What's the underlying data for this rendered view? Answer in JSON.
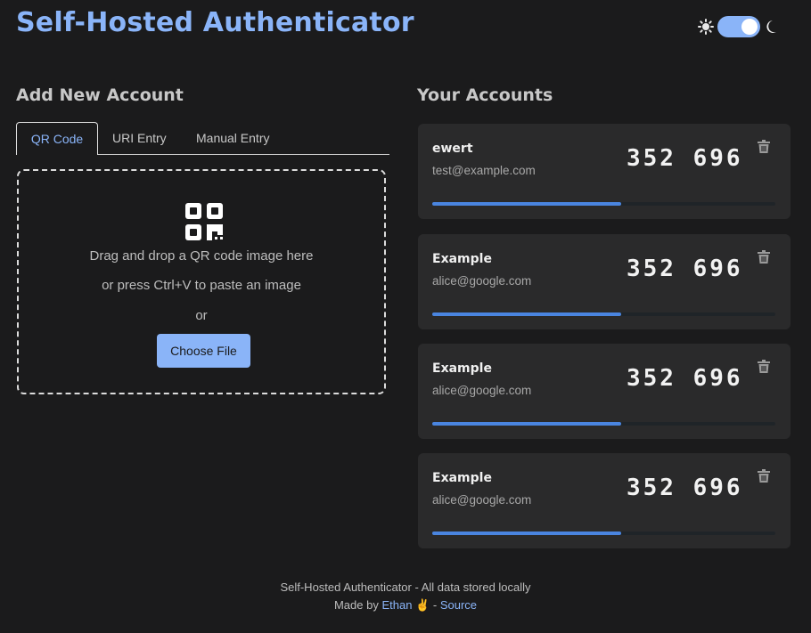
{
  "header": {
    "title": "Self-Hosted Authenticator"
  },
  "theme": {
    "sun_icon": "sun-icon",
    "moon_icon": "moon-icon",
    "dark_mode": true
  },
  "add_section": {
    "title": "Add New Account",
    "tabs": [
      {
        "label": "QR Code",
        "active": true
      },
      {
        "label": "URI Entry",
        "active": false
      },
      {
        "label": "Manual Entry",
        "active": false
      }
    ],
    "dropzone": {
      "icon": "qr-code-icon",
      "line1": "Drag and drop a QR code image here",
      "line2": "or press Ctrl+V to paste an image",
      "line3": "or",
      "button_label": "Choose File"
    }
  },
  "accounts_section": {
    "title": "Your Accounts",
    "accounts": [
      {
        "name": "ewert",
        "email": "test@example.com",
        "code": "352 696",
        "progress": 0.55
      },
      {
        "name": "Example",
        "email": "alice@google.com",
        "code": "352 696",
        "progress": 0.55
      },
      {
        "name": "Example",
        "email": "alice@google.com",
        "code": "352 696",
        "progress": 0.55
      },
      {
        "name": "Example",
        "email": "alice@google.com",
        "code": "352 696",
        "progress": 0.55
      }
    ]
  },
  "footer": {
    "line1": "Self-Hosted Authenticator - All data stored locally",
    "made_by": "Made by",
    "author": "Ethan",
    "author_emoji": "✌",
    "separator": "-",
    "source": "Source"
  },
  "colors": {
    "accent": "#8ab4f8",
    "background": "#1b1b1c",
    "card": "#2a2a2b",
    "progress": "#4a85e0"
  }
}
